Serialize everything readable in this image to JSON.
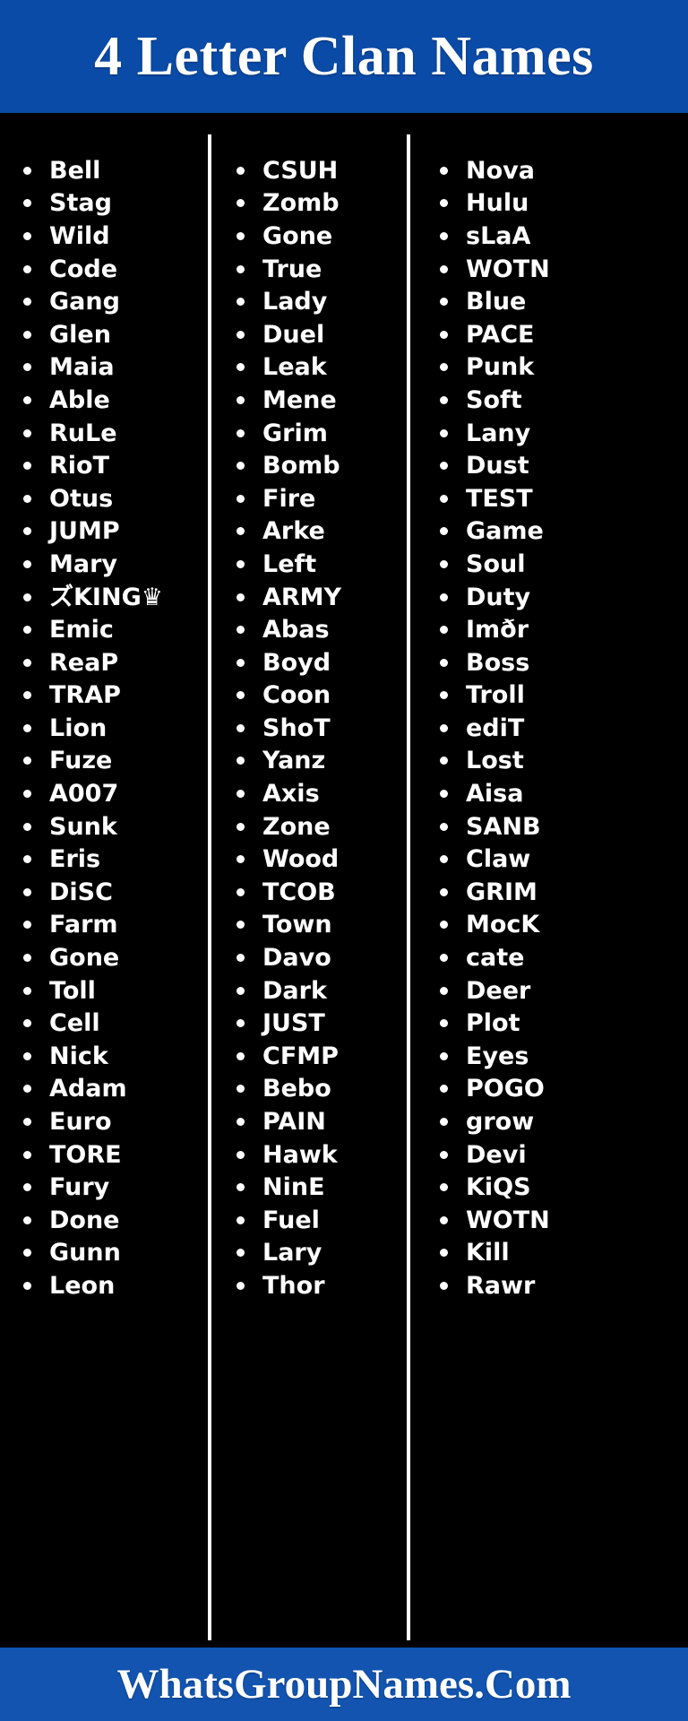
{
  "header": {
    "title": "4 Letter Clan Names",
    "background_color": "#0B4BA8",
    "text_color": "#FFFFFF"
  },
  "body": {
    "background_color": "#000000",
    "divider_color": "#FFFFFF",
    "bullet_glyph": "•"
  },
  "columns": [
    {
      "index": 1,
      "items": [
        "Bell",
        "Stag",
        "Wild",
        "Code",
        "Gang",
        "Glen",
        "Maia",
        "Able",
        "RuLe",
        "RioT",
        "Otus",
        "JUMP",
        "Mary",
        "ズKING♛",
        "Emic",
        "ReaP",
        "TRAP",
        "Lion",
        "Fuze",
        "A007",
        "Sunk",
        "Eris",
        "DiSC",
        "Farm",
        "Gone",
        "Toll",
        "Cell",
        "Nick",
        "Adam",
        "Euro",
        "TORE",
        "Fury",
        "Done",
        "Gunn",
        "Leon"
      ]
    },
    {
      "index": 2,
      "items": [
        "CSUH",
        "Zomb",
        "Gone",
        "True",
        "Lady",
        "Duel",
        "Leak",
        "Mene",
        "Grim",
        "Bomb",
        "Fire",
        "Arke",
        "Left",
        "ARMY",
        "Abas",
        "Boyd",
        "Coon",
        "ShoT",
        "Yanz",
        "Axis",
        "Zone",
        "Wood",
        "TCOB",
        "Town",
        "Davo",
        "Dark",
        "JUST",
        "CFMP",
        "Bebo",
        "PAIN",
        "Hawk",
        "NinE",
        "Fuel",
        "Lary",
        "Thor"
      ]
    },
    {
      "index": 3,
      "items": [
        "Nova",
        "Hulu",
        "sLaA",
        "WOTN",
        "Blue",
        "PACE",
        "Punk",
        "Soft",
        "Lany",
        "Dust",
        "TEST",
        "Game",
        "Soul",
        "Duty",
        "Imðr",
        "Boss",
        "Troll",
        "ediT",
        "Lost",
        "Aisa",
        "SANB",
        "Claw",
        "GRIM",
        "MocK",
        "cate",
        "Deer",
        "Plot",
        "Eyes",
        "POGO",
        "grow",
        "Devi",
        "KiQS",
        "WOTN",
        "Kill",
        "Rawr"
      ]
    }
  ],
  "footer": {
    "text": "WhatsGroupNames.Com",
    "background_color": "#1254B0",
    "text_color": "#FFFFFF"
  }
}
